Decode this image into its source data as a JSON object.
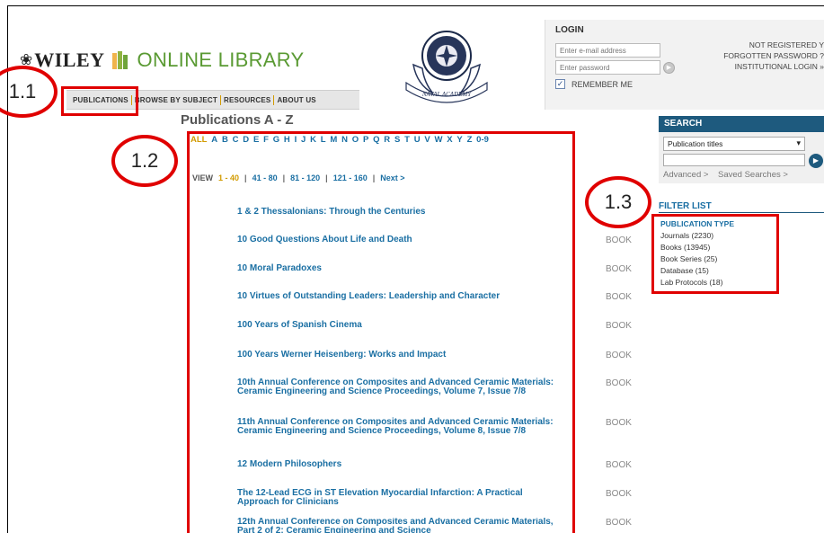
{
  "header": {
    "wiley": "WILEY",
    "online_library": "ONLINE LIBRARY",
    "seal_text": "NAVAL ACADEMY"
  },
  "nav": {
    "items": [
      "PUBLICATIONS",
      "BROWSE BY SUBJECT",
      "RESOURCES",
      "ABOUT US"
    ]
  },
  "login": {
    "title": "LOGIN",
    "email_placeholder": "Enter e-mail address",
    "password_placeholder": "Enter password",
    "remember": "REMEMBER ME",
    "links": [
      "NOT REGISTERED Y",
      "FORGOTTEN PASSWORD ?",
      "INSTITUTIONAL LOGIN »"
    ]
  },
  "main": {
    "title": "Publications A - Z",
    "letters": [
      "ALL",
      "A",
      "B",
      "C",
      "D",
      "E",
      "F",
      "G",
      "H",
      "I",
      "J",
      "K",
      "L",
      "M",
      "N",
      "O",
      "P",
      "Q",
      "R",
      "S",
      "T",
      "U",
      "V",
      "W",
      "X",
      "Y",
      "Z",
      "0-9"
    ],
    "view_label": "VIEW",
    "view_ranges": [
      "1 - 40",
      "41 - 80",
      "81 - 120",
      "121 - 160",
      "Next >"
    ],
    "publications": [
      {
        "title": "1 & 2 Thessalonians: Through the Centuries",
        "type": ""
      },
      {
        "title": "10 Good Questions About Life and Death",
        "type": "BOOK"
      },
      {
        "title": "10 Moral Paradoxes",
        "type": "BOOK"
      },
      {
        "title": "10 Virtues of Outstanding Leaders: Leadership and Character",
        "type": "BOOK"
      },
      {
        "title": "100 Years of Spanish Cinema",
        "type": "BOOK"
      },
      {
        "title": "100 Years Werner Heisenberg: Works and Impact",
        "type": "BOOK"
      },
      {
        "title": "10th Annual Conference on Composites and Advanced Ceramic Materials: Ceramic Engineering and Science Proceedings, Volume 7, Issue 7/8",
        "type": "BOOK"
      },
      {
        "title": "11th Annual Conference on Composites and Advanced Ceramic Materials: Ceramic Engineering and Science Proceedings, Volume 8, Issue 7/8",
        "type": "BOOK"
      },
      {
        "title": "12 Modern Philosophers",
        "type": "BOOK"
      },
      {
        "title": "The 12-Lead ECG in ST Elevation Myocardial Infarction: A Practical Approach for Clinicians",
        "type": "BOOK"
      },
      {
        "title": "12th Annual Conference on Composites and Advanced Ceramic Materials, Part 2 of 2: Ceramic Engineering and Science",
        "type": "BOOK"
      }
    ]
  },
  "search": {
    "title": "SEARCH",
    "select_value": "Publication titles",
    "advanced": "Advanced >",
    "saved": "Saved Searches >"
  },
  "filter": {
    "title": "FILTER LIST",
    "type_title": "PUBLICATION TYPE",
    "items": [
      "Journals (2230)",
      "Books (13945)",
      "Book Series (25)",
      "Database (15)",
      "Lab Protocols (18)"
    ]
  },
  "annotations": [
    "1.1",
    "1.2",
    "1.3"
  ],
  "colors": {
    "link": "#1a6fa3",
    "active": "#d29b00",
    "annotation": "#e00000",
    "brand_green": "#5a9a33",
    "search_header": "#1e5a7e"
  }
}
